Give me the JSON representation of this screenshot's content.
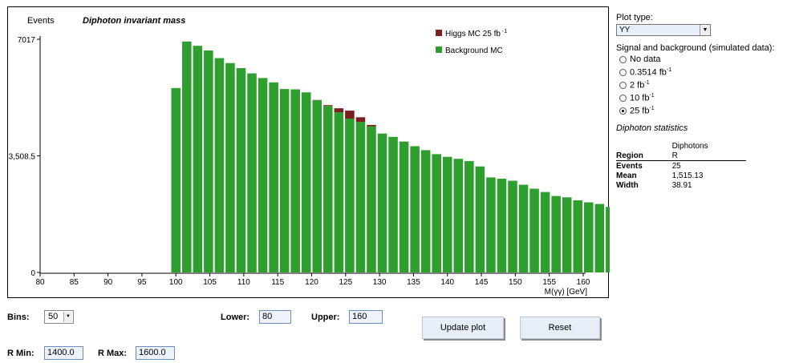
{
  "chart_data": {
    "type": "bar",
    "title": "Diphoton invariant mass",
    "ylabel": "Events",
    "xlabel": "M(γγ) [GeV]",
    "ylim": [
      0,
      7017
    ],
    "y_ticks": [
      "0",
      "3,508.5",
      "7017"
    ],
    "y_tick_values": [
      0,
      3508.5,
      7017
    ],
    "xlim": [
      80,
      160
    ],
    "x_ticks": [
      "80",
      "85",
      "90",
      "95",
      "100",
      "105",
      "110",
      "115",
      "120",
      "125",
      "130",
      "135",
      "140",
      "145",
      "150",
      "155",
      "160"
    ],
    "bin_width": 1.6,
    "bin_start": 99.2,
    "legend": [
      {
        "name": "Higgs MC 25 fb-1",
        "label": "Higgs MC 25 fb",
        "sup": "-1",
        "color": "#7a1f1f"
      },
      {
        "name": "Background MC",
        "label": "Background MC",
        "sup": "",
        "color": "#2e9e2e"
      }
    ],
    "legend_position": "top-right",
    "series": [
      {
        "name": "Background MC",
        "color": "#2e9e2e",
        "values": [
          5550,
          6950,
          6820,
          6680,
          6450,
          6300,
          6150,
          5990,
          5850,
          5720,
          5520,
          5510,
          5420,
          5180,
          5010,
          4820,
          4630,
          4530,
          4400,
          4180,
          4080,
          3940,
          3800,
          3680,
          3560,
          3480,
          3420,
          3350,
          3190,
          2860,
          2820,
          2760,
          2640,
          2520,
          2420,
          2300,
          2260,
          2170,
          2110,
          2060,
          1970
        ]
      },
      {
        "name": "Higgs MC 25 fb-1",
        "color": "#7a1f1f",
        "values": [
          0,
          0,
          0,
          0,
          0,
          0,
          0,
          0,
          0,
          0,
          0,
          0,
          0,
          10,
          25,
          120,
          240,
          140,
          40,
          0,
          0,
          0,
          0,
          0,
          0,
          0,
          0,
          0,
          0,
          0,
          0,
          0,
          0,
          0,
          0,
          0,
          0,
          0,
          0,
          0,
          0
        ]
      }
    ]
  },
  "sidebar": {
    "plot_type_label": "Plot type:",
    "plot_type_value": "YY",
    "signal_label": "Signal and background (simulated data):",
    "options": [
      {
        "label": "No data",
        "sup": "",
        "checked": false
      },
      {
        "label": "0.3514 fb",
        "sup": "-1",
        "checked": false
      },
      {
        "label": "2 fb",
        "sup": "-1",
        "checked": false
      },
      {
        "label": "10 fb",
        "sup": "-1",
        "checked": false
      },
      {
        "label": "25 fb",
        "sup": "-1",
        "checked": true
      }
    ],
    "stats_title": "Diphoton statistics",
    "stats_group_header": "Diphotons",
    "stats_col_region": "Region",
    "stats_col_r": "R",
    "stats_rows": [
      {
        "label": "Events",
        "value": "25"
      },
      {
        "label": "Mean",
        "value": "1,515.13"
      },
      {
        "label": "Width",
        "value": "38.91"
      }
    ]
  },
  "controls": {
    "bins_label": "Bins:",
    "bins_value": "50",
    "lower_label": "Lower:",
    "lower_value": "80",
    "upper_label": "Upper:",
    "upper_value": "160",
    "update_button": "Update plot",
    "reset_button": "Reset",
    "rmin_label": "R Min:",
    "rmin_value": "1400.0",
    "rmax_label": "R Max:",
    "rmax_value": "1600.0"
  }
}
